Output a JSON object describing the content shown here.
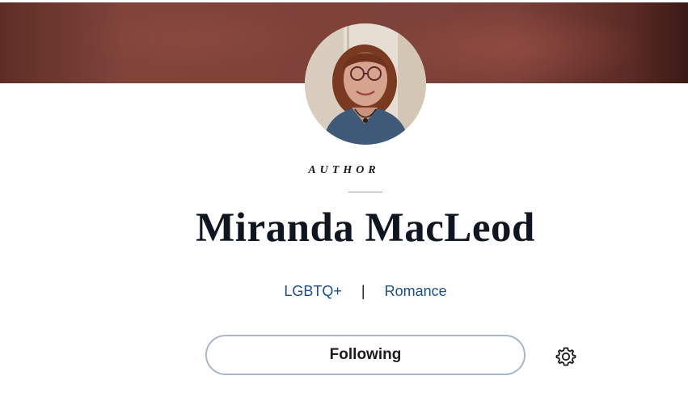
{
  "profile": {
    "role_label": "AUTHOR",
    "name": "Miranda MacLeod",
    "genres": [
      "LGBTQ+",
      "Romance"
    ],
    "genre_separator": "|"
  },
  "actions": {
    "follow_label": "Following",
    "settings_icon": "gear-icon"
  },
  "colors": {
    "banner": "#7e4239",
    "link": "#1a4e8a",
    "button_border": "#a8b6c8",
    "heading": "#0f1620"
  }
}
